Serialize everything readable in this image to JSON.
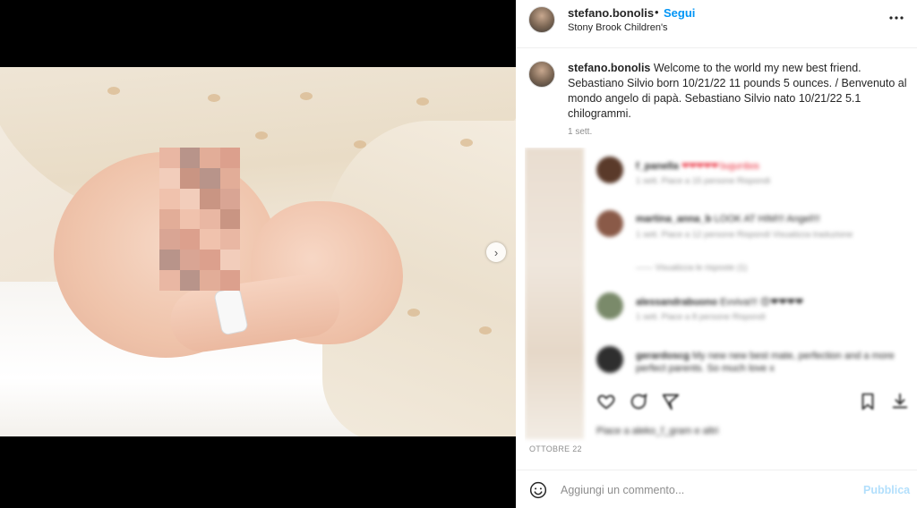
{
  "post": {
    "author": "stefano.bonolis",
    "separator": "•",
    "follow_label": "Segui",
    "location": "Stony Brook Children's",
    "more_icon": "more-horizontal-icon",
    "caption_author": "stefano.bonolis",
    "caption_text": " Welcome to the world my new best friend. Sebastiano Silvio born 10/21/22 11 pounds 5 ounces. / Benvenuto al mondo angelo di papà. Sebastiano Silvio nato 10/21/22 5.1 chilogrammi.",
    "caption_time": "1 sett.",
    "date": "OTTOBRE 22"
  },
  "media": {
    "next_icon": "chevron-right-icon",
    "next_glyph": "›"
  },
  "comments": [
    {
      "user": "f_panella",
      "text": "❤❤❤❤❤ bugumbos",
      "meta": "1 sett.   Piace a 15 persone   Rispondi",
      "avatar_color": "#5a3a2a"
    },
    {
      "user": "martina_anna_b",
      "text": "LOOK AT HIM!!! Angel!!!",
      "meta": "1 sett.   Piace a 12 persone   Rispondi   Visualizza traduzione",
      "avatar_color": "#8a5a48"
    },
    {
      "user": "",
      "text": "",
      "meta": "—— Visualizza le risposte (1)",
      "avatar_color": ""
    },
    {
      "user": "alessandrabuono",
      "text": "Evviva!!! 😍❤❤❤❤",
      "meta": "1 sett.   Piace a 8 persone   Rispondi",
      "avatar_color": "#7a8a6a"
    },
    {
      "user": "gerardoscg",
      "text": "My new new best mate, perfection and a more perfect parents. So much love x",
      "meta": "",
      "avatar_color": "#2e2e2e"
    }
  ],
  "likes_text": "Piace a aleko_f_gram e altri",
  "comment_bar": {
    "placeholder": "Aggiungi un commento...",
    "publish_label": "Pubblica",
    "emoji_icon": "emoji-smile-icon"
  },
  "actions": {
    "like_icon": "heart-icon",
    "comment_icon": "comment-icon",
    "share_icon": "share-icon",
    "save_icon": "bookmark-icon",
    "download_icon": "download-icon"
  },
  "colors": {
    "accent": "#0095f6",
    "publish_disabled": "#b2dffc",
    "muted": "#8e8e8e",
    "text": "#262626"
  }
}
